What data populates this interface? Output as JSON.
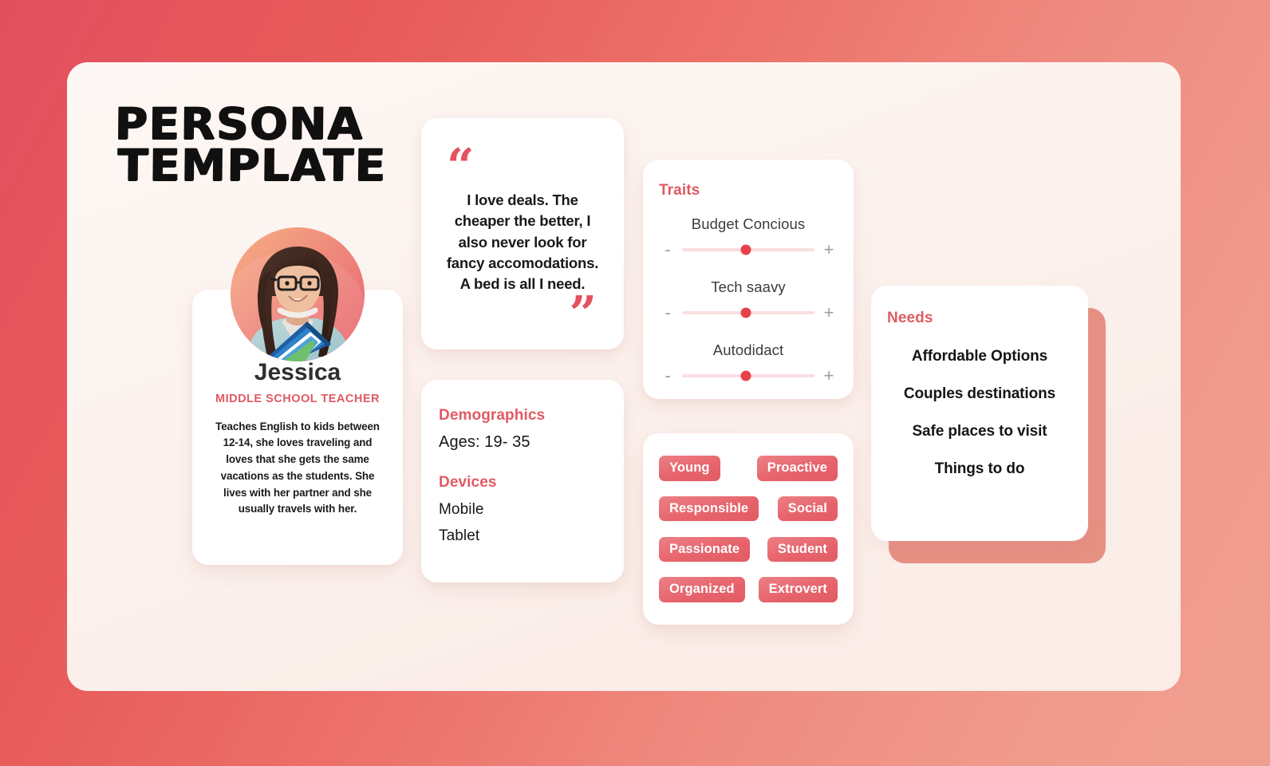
{
  "page": {
    "title_line1": "PERSONA",
    "title_line2": "TEMPLATE",
    "background_gradient_from": "#e2505f",
    "background_gradient_to": "#ef9f90",
    "panel_background": "#fbf0ec",
    "accent_color": "#e05a63"
  },
  "profile": {
    "avatar_alt": "Jessica portrait",
    "name": "Jessica",
    "role": "MIDDLE SCHOOL TEACHER",
    "description": "Teaches English to kids between 12-14, she loves traveling and loves that she gets the same vacations as the students. She lives with her partner and she usually travels with her."
  },
  "quote": {
    "open_mark": "“",
    "close_mark": "”",
    "text": "I love deals. The cheaper the better, I also never look for fancy accomodations. A bed is all I need."
  },
  "demographics": {
    "heading": "Demographics",
    "ages_label": "Ages: 19- 35",
    "devices_heading": "Devices",
    "devices": [
      "Mobile",
      "Tablet"
    ]
  },
  "traits": {
    "heading": "Traits",
    "minus_label": "-",
    "plus_label": "+",
    "items": [
      {
        "label": "Budget Concious",
        "value": 48
      },
      {
        "label": "Tech saavy",
        "value": 48
      },
      {
        "label": "Autodidact",
        "value": 48
      }
    ]
  },
  "tags": {
    "rows": [
      [
        "Young",
        "Proactive"
      ],
      [
        "Responsible",
        "Social"
      ],
      [
        "Passionate",
        "Student"
      ],
      [
        "Organized",
        "Extrovert"
      ]
    ]
  },
  "needs": {
    "heading": "Needs",
    "items": [
      "Affordable Options",
      "Couples destinations",
      "Safe places to visit",
      "Things to do"
    ]
  }
}
